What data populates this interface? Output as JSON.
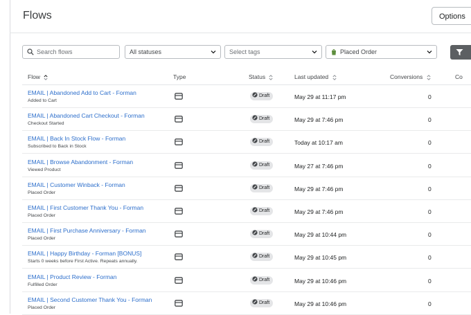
{
  "page": {
    "title": "Flows"
  },
  "toolbar": {
    "options_label": "Options"
  },
  "filters": {
    "search_placeholder": "Search flows",
    "status_value": "All statuses",
    "tags_placeholder": "Select tags",
    "trigger_value": "Placed Order"
  },
  "columns": {
    "flow": "Flow",
    "type": "Type",
    "status": "Status",
    "last_updated": "Last updated",
    "conversions": "Conversions",
    "cut": "Co"
  },
  "rows": [
    {
      "name": "EMAIL | Abandoned Add to Cart - Forman",
      "trigger": "Added to Cart",
      "status": "Draft",
      "updated": "May 29 at 11:17 pm",
      "conversions": "0"
    },
    {
      "name": "EMAIL | Abandoned Cart Checkout - Forman",
      "trigger": "Checkout Started",
      "status": "Draft",
      "updated": "May 29 at 7:46 pm",
      "conversions": "0"
    },
    {
      "name": "EMAIL | Back In Stock Flow - Forman",
      "trigger": "Subscribed to Back in Stock",
      "status": "Draft",
      "updated": "Today at 10:17 am",
      "conversions": "0"
    },
    {
      "name": "EMAIL | Browse Abandonment - Forman",
      "trigger": "Viewed Product",
      "status": "Draft",
      "updated": "May 27 at 7:46 pm",
      "conversions": "0"
    },
    {
      "name": "EMAIL | Customer Winback - Forman",
      "trigger": "Placed Order",
      "status": "Draft",
      "updated": "May 29 at 7:46 pm",
      "conversions": "0"
    },
    {
      "name": "EMAIL | First Customer Thank You - Forman",
      "trigger": "Placed Order",
      "status": "Draft",
      "updated": "May 29 at 7:46 pm",
      "conversions": "0"
    },
    {
      "name": "EMAIL | First Purchase Anniversary - Forman",
      "trigger": "Placed Order",
      "status": "Draft",
      "updated": "May 29 at 10:44 pm",
      "conversions": "0"
    },
    {
      "name": "EMAIL | Happy Birthday - Forman [BONUS]",
      "trigger": "Starts 0 weeks before First Active. Repeats annually.",
      "status": "Draft",
      "updated": "May 29 at 10:45 pm",
      "conversions": "0"
    },
    {
      "name": "EMAIL | Product Review - Forman",
      "trigger": "Fulfilled Order",
      "status": "Draft",
      "updated": "May 29 at 10:46 pm",
      "conversions": "0"
    },
    {
      "name": "EMAIL | Second Customer Thank You - Forman",
      "trigger": "Placed Order",
      "status": "Draft",
      "updated": "May 29 at 10:46 pm",
      "conversions": "0"
    }
  ]
}
